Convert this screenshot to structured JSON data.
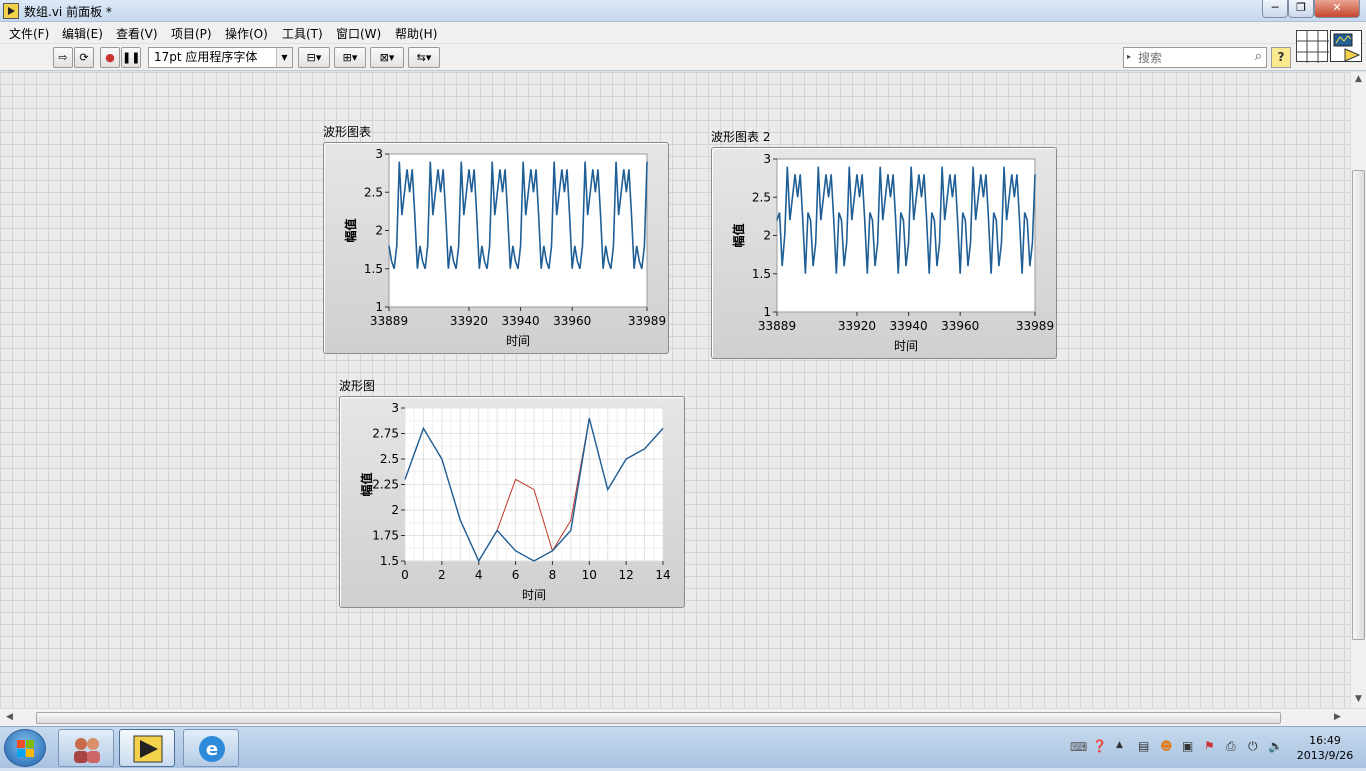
{
  "window": {
    "title": "数组.vi 前面板 *"
  },
  "menu": [
    "文件(F)",
    "编辑(E)",
    "查看(V)",
    "项目(P)",
    "操作(O)",
    "工具(T)",
    "窗口(W)",
    "帮助(H)"
  ],
  "toolbar": {
    "font_label": "17pt 应用程序字体"
  },
  "search": {
    "placeholder": "搜索"
  },
  "help_label": "?",
  "charts": {
    "chart1": {
      "label": "波形图表",
      "ylabel": "幅值",
      "xlabel": "时间"
    },
    "chart2": {
      "label": "波形图表 2",
      "ylabel": "幅值",
      "xlabel": "时间"
    },
    "graph": {
      "label": "波形图",
      "ylabel": "幅值",
      "xlabel": "时间"
    }
  },
  "chart_data": [
    {
      "type": "line",
      "title": "波形图表",
      "xlabel": "时间",
      "ylabel": "幅值",
      "ylim": [
        1,
        3
      ],
      "xlim": [
        33889,
        33989
      ],
      "yticks": [
        "3",
        "2.5",
        "2",
        "1.5",
        "1"
      ],
      "xticks": [
        "33889",
        "33920",
        "33940",
        "33960",
        "33989"
      ],
      "grid": false,
      "series": [
        {
          "color": "#1f5f96",
          "x": [
            33889,
            33890,
            33891,
            33892,
            33893,
            33894,
            33895,
            33896,
            33897,
            33898,
            33899,
            33900,
            33901,
            33902,
            33903,
            33904,
            33905,
            33906,
            33907,
            33908,
            33909,
            33910,
            33911,
            33912,
            33913,
            33914,
            33915,
            33916,
            33917,
            33918,
            33919,
            33920,
            33921,
            33922,
            33923,
            33924,
            33925,
            33926,
            33927,
            33928,
            33929,
            33930,
            33931,
            33932,
            33933,
            33934,
            33935,
            33936,
            33937,
            33938,
            33939,
            33940,
            33941,
            33942,
            33943,
            33944,
            33945,
            33946,
            33947,
            33948,
            33949,
            33950,
            33951,
            33952,
            33953,
            33954,
            33955,
            33956,
            33957,
            33958,
            33959,
            33960,
            33961,
            33962,
            33963,
            33964,
            33965,
            33966,
            33967,
            33968,
            33969,
            33970,
            33971,
            33972,
            33973,
            33974,
            33975,
            33976,
            33977,
            33978,
            33979,
            33980,
            33981,
            33982,
            33983,
            33984,
            33985,
            33986,
            33987,
            33988,
            33989
          ],
          "values": [
            1.8,
            1.6,
            1.5,
            1.8,
            2.9,
            2.2,
            2.5,
            2.8,
            2.5,
            2.8,
            2.2,
            1.5,
            1.8,
            1.6,
            1.5,
            1.8,
            2.9,
            2.2,
            2.5,
            2.8,
            2.5,
            2.8,
            2.2,
            1.5,
            1.8,
            1.6,
            1.5,
            1.8,
            2.9,
            2.2,
            2.5,
            2.8,
            2.5,
            2.8,
            2.2,
            1.5,
            1.8,
            1.6,
            1.5,
            1.8,
            2.9,
            2.2,
            2.5,
            2.8,
            2.5,
            2.8,
            2.2,
            1.5,
            1.8,
            1.6,
            1.5,
            1.8,
            2.9,
            2.2,
            2.5,
            2.8,
            2.5,
            2.8,
            2.2,
            1.5,
            1.8,
            1.6,
            1.5,
            1.8,
            2.9,
            2.2,
            2.5,
            2.8,
            2.5,
            2.8,
            2.2,
            1.5,
            1.8,
            1.6,
            1.5,
            1.8,
            2.9,
            2.2,
            2.5,
            2.8,
            2.5,
            2.8,
            2.2,
            1.5,
            1.8,
            1.6,
            1.5,
            1.8,
            2.9,
            2.2,
            2.5,
            2.8,
            2.5,
            2.8,
            2.2,
            1.5,
            1.8,
            1.6,
            1.5,
            1.8,
            2.9
          ]
        }
      ]
    },
    {
      "type": "line",
      "title": "波形图表 2",
      "xlabel": "时间",
      "ylabel": "幅值",
      "ylim": [
        1,
        3
      ],
      "xlim": [
        33889,
        33989
      ],
      "yticks": [
        "3",
        "2.5",
        "2",
        "1.5",
        "1"
      ],
      "xticks": [
        "33889",
        "33920",
        "33940",
        "33960",
        "33989"
      ],
      "grid": false,
      "series": [
        {
          "color": "#1f5f96",
          "x": [
            33889,
            33890,
            33891,
            33892,
            33893,
            33894,
            33895,
            33896,
            33897,
            33898,
            33899,
            33900,
            33901,
            33902,
            33903,
            33904,
            33905,
            33906,
            33907,
            33908,
            33909,
            33910,
            33911,
            33912,
            33913,
            33914,
            33915,
            33916,
            33917,
            33918,
            33919,
            33920,
            33921,
            33922,
            33923,
            33924,
            33925,
            33926,
            33927,
            33928,
            33929,
            33930,
            33931,
            33932,
            33933,
            33934,
            33935,
            33936,
            33937,
            33938,
            33939,
            33940,
            33941,
            33942,
            33943,
            33944,
            33945,
            33946,
            33947,
            33948,
            33949,
            33950,
            33951,
            33952,
            33953,
            33954,
            33955,
            33956,
            33957,
            33958,
            33959,
            33960,
            33961,
            33962,
            33963,
            33964,
            33965,
            33966,
            33967,
            33968,
            33969,
            33970,
            33971,
            33972,
            33973,
            33974,
            33975,
            33976,
            33977,
            33978,
            33979,
            33980,
            33981,
            33982,
            33983,
            33984,
            33985,
            33986,
            33987,
            33988,
            33989
          ],
          "values": [
            2.2,
            2.3,
            1.6,
            2.0,
            2.9,
            2.2,
            2.5,
            2.8,
            2.5,
            2.8,
            2.2,
            1.5,
            2.3,
            2.2,
            1.6,
            1.9,
            2.9,
            2.2,
            2.5,
            2.8,
            2.5,
            2.8,
            2.2,
            1.5,
            2.3,
            2.2,
            1.6,
            1.9,
            2.9,
            2.2,
            2.5,
            2.8,
            2.5,
            2.8,
            2.2,
            1.5,
            2.3,
            2.2,
            1.6,
            1.9,
            2.9,
            2.2,
            2.5,
            2.8,
            2.5,
            2.8,
            2.2,
            1.5,
            2.3,
            2.2,
            1.6,
            1.9,
            2.9,
            2.2,
            2.5,
            2.8,
            2.5,
            2.8,
            2.2,
            1.5,
            2.3,
            2.2,
            1.6,
            1.9,
            2.9,
            2.2,
            2.5,
            2.8,
            2.5,
            2.8,
            2.2,
            1.5,
            2.3,
            2.2,
            1.6,
            1.9,
            2.9,
            2.2,
            2.5,
            2.8,
            2.5,
            2.8,
            2.2,
            1.5,
            2.3,
            2.2,
            1.6,
            1.9,
            2.9,
            2.2,
            2.5,
            2.8,
            2.5,
            2.8,
            2.2,
            1.5,
            2.3,
            2.2,
            1.6,
            1.9,
            2.8
          ]
        }
      ]
    },
    {
      "type": "line",
      "title": "波形图",
      "xlabel": "时间",
      "ylabel": "幅值",
      "ylim": [
        1.5,
        3
      ],
      "xlim": [
        0,
        14
      ],
      "yticks": [
        "3",
        "2.75",
        "2.5",
        "2.25",
        "2",
        "1.75",
        "1.5"
      ],
      "xticks": [
        "0",
        "2",
        "4",
        "6",
        "8",
        "10",
        "12",
        "14"
      ],
      "grid": true,
      "series": [
        {
          "color": "#c0392b",
          "x": [
            0,
            1,
            2,
            3,
            4,
            5,
            6,
            7,
            8,
            9,
            10,
            11,
            12,
            13,
            14
          ],
          "values": [
            2.3,
            2.8,
            2.5,
            1.9,
            1.5,
            1.8,
            2.3,
            2.2,
            1.6,
            1.9,
            2.9,
            2.2,
            2.5,
            2.6,
            2.8
          ]
        },
        {
          "color": "#1f5f96",
          "x": [
            0,
            1,
            2,
            3,
            4,
            5,
            6,
            7,
            8,
            9,
            10,
            11,
            12,
            13,
            14
          ],
          "values": [
            2.3,
            2.8,
            2.5,
            1.9,
            1.5,
            1.8,
            1.6,
            1.5,
            1.6,
            1.8,
            2.9,
            2.2,
            2.5,
            2.6,
            2.8
          ]
        }
      ]
    }
  ],
  "taskbar": {
    "time": "16:49",
    "date": "2013/9/26"
  }
}
